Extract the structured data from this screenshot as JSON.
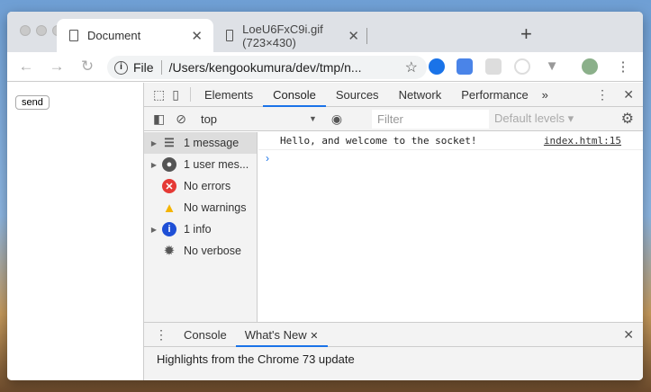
{
  "browser": {
    "tabs": [
      {
        "title": "Document",
        "active": true
      },
      {
        "title": "LoeU6FxC9i.gif (723×430)",
        "active": false
      }
    ],
    "address": {
      "scheme_label": "File",
      "url": "/Users/kengookumura/dev/tmp/n..."
    }
  },
  "page": {
    "send_label": "send"
  },
  "devtools": {
    "tabs": [
      "Elements",
      "Console",
      "Sources",
      "Network",
      "Performance"
    ],
    "active_tab": "Console",
    "more": "»",
    "context": "top",
    "filter_placeholder": "Filter",
    "levels": "Default levels ▾",
    "sidebar": [
      {
        "label": "1 message",
        "icon": "list-icon",
        "expandable": true,
        "selected": true
      },
      {
        "label": "1 user mes...",
        "icon": "user-icon",
        "expandable": true
      },
      {
        "label": "No errors",
        "icon": "error-icon"
      },
      {
        "label": "No warnings",
        "icon": "warning-icon"
      },
      {
        "label": "1 info",
        "icon": "info-icon",
        "expandable": true
      },
      {
        "label": "No verbose",
        "icon": "bug-icon"
      }
    ],
    "messages": [
      {
        "text": "Hello, and welcome to the socket!",
        "source": "index.html:15"
      }
    ],
    "drawer": {
      "tabs": [
        "Console",
        "What's New"
      ],
      "active": "What's New",
      "content": "Highlights from the Chrome 73 update"
    }
  },
  "colors": {
    "accent": "#1a73e8",
    "error": "#e53935",
    "warning": "#f4b400",
    "info": "#1e4fd6"
  }
}
